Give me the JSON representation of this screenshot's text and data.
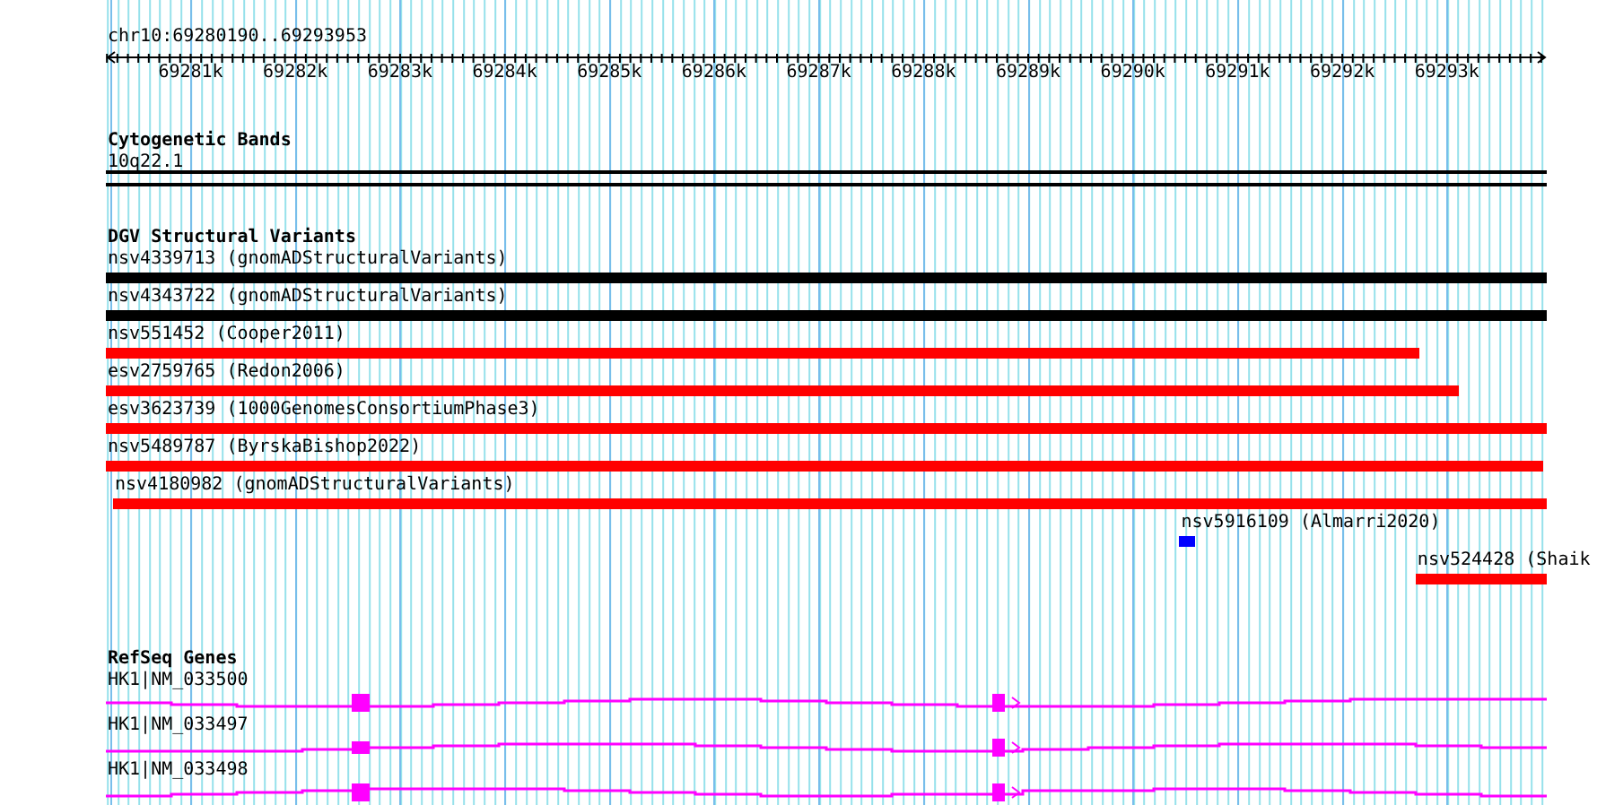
{
  "scale": {
    "title": "chr10:69280190..69293953",
    "ticks": [
      "69281k",
      "69282k",
      "69283k",
      "69284k",
      "69285k",
      "69286k",
      "69287k",
      "69288k",
      "69289k",
      "69290k",
      "69291k",
      "69292k",
      "69293k"
    ]
  },
  "tracks": [
    {
      "kind": "cytoband",
      "title": "Cytogenetic Bands",
      "features": [
        {
          "label": "10q22.1"
        }
      ]
    },
    {
      "kind": "variants",
      "title": "DGV Structural Variants",
      "features": [
        {
          "label": "nsv4339713 (gnomADStructuralVariants)",
          "color": "#000000"
        },
        {
          "label": "nsv4343722 (gnomADStructuralVariants)",
          "color": "#000000"
        },
        {
          "label": "nsv551452 (Cooper2011)",
          "color": "#ff0000"
        },
        {
          "label": "esv2759765 (Redon2006)",
          "color": "#ff0000"
        },
        {
          "label": "esv3623739 (1000GenomesConsortiumPhase3)",
          "color": "#ff0000"
        },
        {
          "label": "nsv5489787 (ByrskaBishop2022)",
          "color": "#ff0000"
        },
        {
          "label": "nsv4180982 (gnomADStructuralVariants)",
          "color": "#ff0000"
        },
        {
          "label": "nsv5916109 (Almarri2020)",
          "color": "#0000ff"
        },
        {
          "label": "nsv524428 (Shaik",
          "color": "#ff0000"
        }
      ]
    },
    {
      "kind": "genes",
      "title": "RefSeq Genes",
      "features": [
        {
          "label": "HK1|NM_033500"
        },
        {
          "label": "HK1|NM_033497"
        },
        {
          "label": "HK1|NM_033498"
        }
      ]
    }
  ]
}
